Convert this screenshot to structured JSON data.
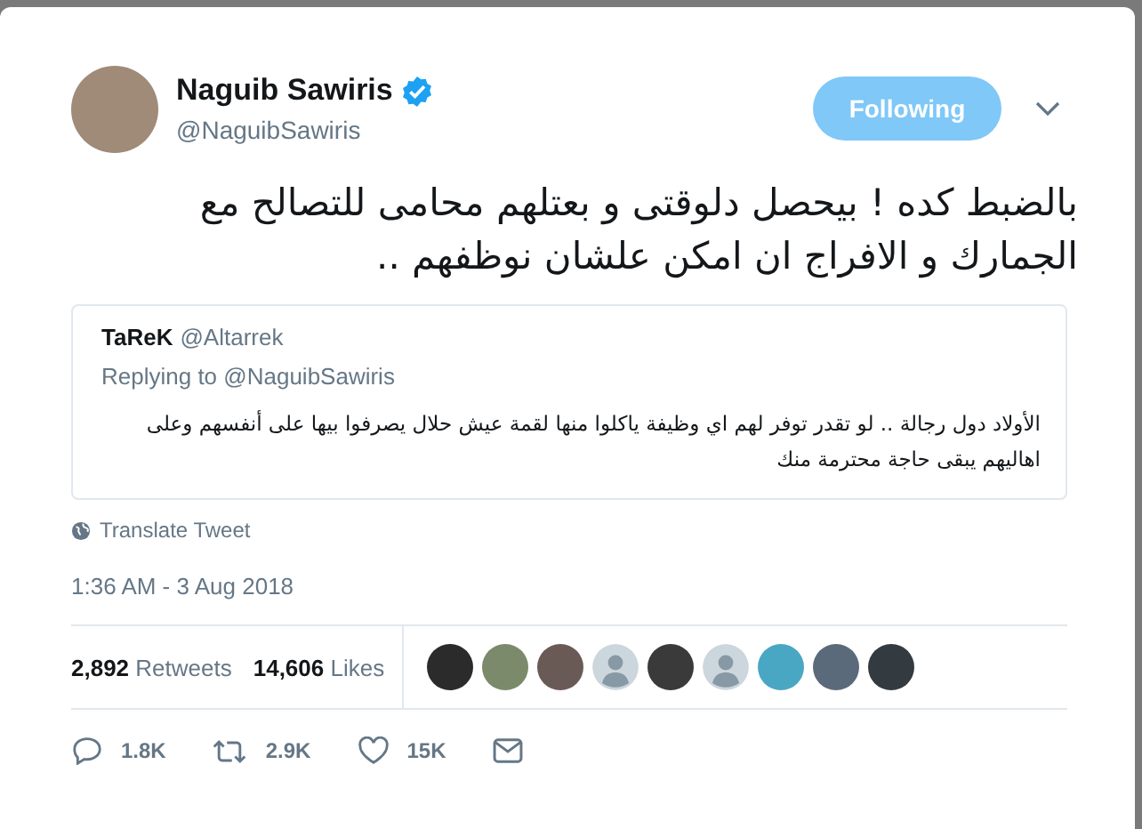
{
  "author": {
    "name": "Naguib Sawiris",
    "handle": "@NaguibSawiris",
    "verified": true
  },
  "follow_button": {
    "label": "Following"
  },
  "tweet_text": "بالضبط كده ! بيحصل دلوقتى و بعتلهم  محامى للتصالح مع الجمارك و الافراج ان امكن علشان نوظفهم ..",
  "quoted_tweet": {
    "name": "TaReK",
    "handle": "@Altarrek",
    "replying_to": "Replying to @NaguibSawiris",
    "text": "الأولاد دول رجالة .. لو تقدر توفر لهم اي وظيفة ياكلوا منها لقمة عيش حلال يصرفوا بيها على أنفسهم وعلى اهاليهم يبقى حاجة محترمة منك"
  },
  "translate_link": "Translate Tweet",
  "timestamp": "1:36 AM - 3 Aug 2018",
  "stats": [
    {
      "count": "2,892",
      "label": "Retweets"
    },
    {
      "count": "14,606",
      "label": "Likes"
    }
  ],
  "likers": [
    {
      "kind": "photo"
    },
    {
      "kind": "photo"
    },
    {
      "kind": "photo"
    },
    {
      "kind": "default"
    },
    {
      "kind": "photo"
    },
    {
      "kind": "default"
    },
    {
      "kind": "photo"
    },
    {
      "kind": "photo"
    },
    {
      "kind": "photo"
    }
  ],
  "actions": [
    {
      "kind": "reply",
      "count": "1.8K"
    },
    {
      "kind": "retweet",
      "count": "2.9K"
    },
    {
      "kind": "like",
      "count": "15K"
    },
    {
      "kind": "message"
    }
  ]
}
